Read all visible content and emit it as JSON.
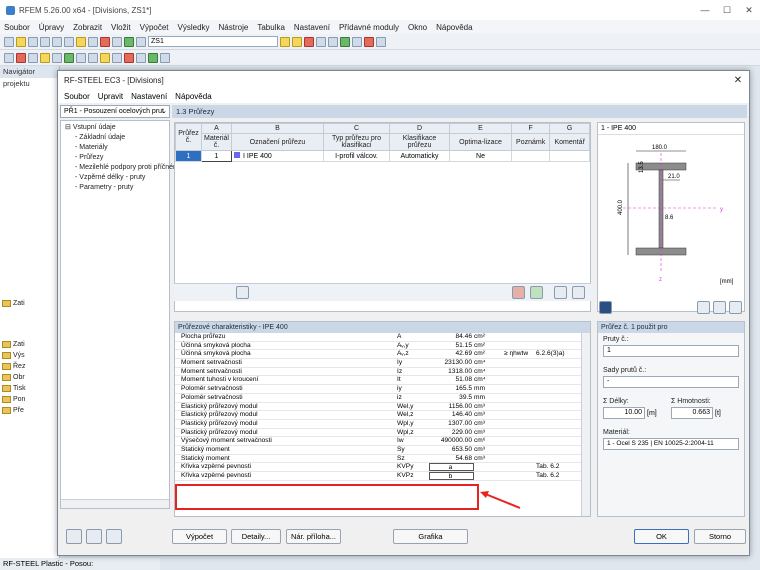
{
  "app": {
    "title": "RFEM 5.26.00 x64 - [Divisions, ZS1*]",
    "menu": [
      "Soubor",
      "Úpravy",
      "Zobrazit",
      "Vložit",
      "Výpočet",
      "Výsledky",
      "Nástroje",
      "Tabulka",
      "Nastavení",
      "Přídavné moduly",
      "Okno",
      "Nápověda"
    ],
    "combo_value": "ZS1"
  },
  "navigator": {
    "header": "Navigátor projektu",
    "items": [
      "Zati",
      "Zati",
      "Výs",
      "Řez",
      "Obr",
      "Tisk",
      "Pon",
      "Pře"
    ],
    "footer": "RF-STEEL Plastic - Posou:"
  },
  "dialog": {
    "title": "RF-STEEL EC3 - [Divisions]",
    "menu": [
      "Soubor",
      "Upravit",
      "Nastavení",
      "Nápověda"
    ],
    "case_select": "PŘ1 - Posouzení ocelových prut",
    "section_header": "1.3 Průřezy",
    "tree": [
      "Vstupní údaje",
      "Základní údaje",
      "Materiály",
      "Průřezy",
      "Mezilehlé podpory proti příčném",
      "Vzpěrné délky - pruty",
      "Parametry - pruty"
    ],
    "table": {
      "col_letters": [
        "A",
        "B",
        "C",
        "D",
        "E",
        "F",
        "G"
      ],
      "headers": [
        "Průřez č.",
        "Materiál č.",
        "Označení průřezu",
        "Typ průřezu pro klasifikaci",
        "Klasifikace průřezu",
        "Optima-lizace",
        "Poznámk",
        "Komentář"
      ],
      "row": {
        "no": "1",
        "mat": "1",
        "name": "IPE 400",
        "type": "I-profil válcov.",
        "class": "Automaticky",
        "opt": "Ne"
      }
    },
    "preview": {
      "title": "1 - IPE 400",
      "dim_top": "180.0",
      "dim_flange": "13.5",
      "dim_web_side": "21.0",
      "dim_height": "400.0",
      "dim_web": "8.6",
      "unit": "[mm]",
      "y_label": "y",
      "z_label": "z"
    },
    "props_header": "Průřezové charakteristiky - IPE 400",
    "props": [
      {
        "name": "Plocha průřezu",
        "sym": "A",
        "val": "84.46",
        "unit": "cm²",
        "x": "",
        "y": ""
      },
      {
        "name": "Účinná smyková plocha",
        "sym": "Aᵥ,y",
        "val": "51.15",
        "unit": "cm²",
        "x": "",
        "y": ""
      },
      {
        "name": "Účinná smyková plocha",
        "sym": "Aᵥ,z",
        "val": "42.69",
        "unit": "cm²",
        "x": "≥ ηhwtw",
        "y": "6.2.6(3)a)"
      },
      {
        "name": "Moment setrvačnosti",
        "sym": "Iy",
        "val": "23130.00",
        "unit": "cm⁴",
        "x": "",
        "y": ""
      },
      {
        "name": "Moment setrvačnosti",
        "sym": "Iz",
        "val": "1318.00",
        "unit": "cm⁴",
        "x": "",
        "y": ""
      },
      {
        "name": "Moment tuhosti v kroucení",
        "sym": "It",
        "val": "51.08",
        "unit": "cm⁴",
        "x": "",
        "y": ""
      },
      {
        "name": "Poloměr setrvačnosti",
        "sym": "iy",
        "val": "165.5",
        "unit": "mm",
        "x": "",
        "y": ""
      },
      {
        "name": "Poloměr setrvačnosti",
        "sym": "iz",
        "val": "39.5",
        "unit": "mm",
        "x": "",
        "y": ""
      },
      {
        "name": "Elastický průřezový modul",
        "sym": "Wel,y",
        "val": "1156.00",
        "unit": "cm³",
        "x": "",
        "y": ""
      },
      {
        "name": "Elastický průřezový modul",
        "sym": "Wel,z",
        "val": "146.40",
        "unit": "cm³",
        "x": "",
        "y": ""
      },
      {
        "name": "Plastický průřezový modul",
        "sym": "Wpl,y",
        "val": "1307.00",
        "unit": "cm³",
        "x": "",
        "y": ""
      },
      {
        "name": "Plastický průřezový modul",
        "sym": "Wpl,z",
        "val": "229.00",
        "unit": "cm³",
        "x": "",
        "y": ""
      },
      {
        "name": "Výsečový moment setrvačnosti",
        "sym": "Iw",
        "val": "490000.00",
        "unit": "cm⁶",
        "x": "",
        "y": ""
      },
      {
        "name": "Statický moment",
        "sym": "Sy",
        "val": "653.50",
        "unit": "cm³",
        "x": "",
        "y": ""
      },
      {
        "name": "Statický moment",
        "sym": "Sz",
        "val": "54.68",
        "unit": "cm³",
        "x": "",
        "y": ""
      },
      {
        "name": "Křivka vzpěrné pevnosti",
        "sym": "KVPy",
        "val": "a",
        "unit": "",
        "x": "",
        "y": "Tab. 6.2"
      },
      {
        "name": "Křivka vzpěrné pevnosti",
        "sym": "KVPz",
        "val": "b",
        "unit": "",
        "x": "",
        "y": "Tab. 6.2"
      }
    ],
    "side": {
      "header": "Průřez č. 1 použit pro",
      "bars_label": "Pruty č.:",
      "bars_value": "1",
      "sets_label": "Sady prutů č.:",
      "sets_value": "-",
      "len_label": "Σ Délky:",
      "len_value": "10.00",
      "len_unit": "[m]",
      "mass_label": "Σ Hmotnosti:",
      "mass_value": "0.663",
      "mass_unit": "[t]",
      "mat_label": "Materiál:",
      "mat_value": "1 - Ocel S 235 | EN 10025-2:2004-11"
    },
    "footer": {
      "calc": "Výpočet",
      "details": "Detaily...",
      "nat": "Nár. příloha...",
      "graphics": "Grafika",
      "ok": "OK",
      "cancel": "Storno"
    }
  }
}
